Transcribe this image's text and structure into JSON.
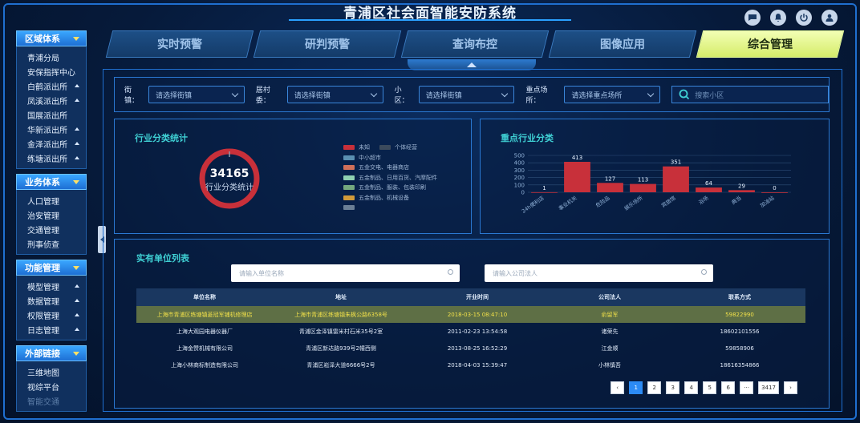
{
  "app": {
    "title": "青浦区社会面智能安防系统"
  },
  "header": {
    "icons": [
      "chat-icon",
      "bell-icon",
      "power-icon",
      "user-icon"
    ]
  },
  "tabs": [
    {
      "label": "实时预警",
      "active": false
    },
    {
      "label": "研判预警",
      "active": false
    },
    {
      "label": "查询布控",
      "active": false
    },
    {
      "label": "图像应用",
      "active": false
    },
    {
      "label": "综合管理",
      "active": true
    }
  ],
  "sidebar": {
    "groups": [
      {
        "label": "区域体系",
        "items": [
          {
            "label": "青浦分局",
            "expand": false
          },
          {
            "label": "安保指挥中心",
            "expand": false
          },
          {
            "label": "白鹤派出所",
            "expand": true
          },
          {
            "label": "凤溪派出所",
            "expand": true
          },
          {
            "label": "国展派出所",
            "expand": false
          },
          {
            "label": "华新派出所",
            "expand": true
          },
          {
            "label": "金泽派出所",
            "expand": true
          },
          {
            "label": "练塘派出所",
            "expand": true
          }
        ]
      },
      {
        "label": "业务体系",
        "items": [
          {
            "label": "人口管理",
            "expand": false
          },
          {
            "label": "治安管理",
            "expand": false
          },
          {
            "label": "交通管理",
            "expand": false
          },
          {
            "label": "刑事侦查",
            "expand": false
          }
        ]
      },
      {
        "label": "功能管理",
        "items": [
          {
            "label": "模型管理",
            "expand": true
          },
          {
            "label": "数据管理",
            "expand": true
          },
          {
            "label": "权限管理",
            "expand": true
          },
          {
            "label": "日志管理",
            "expand": true
          }
        ]
      },
      {
        "label": "外部链接",
        "items": [
          {
            "label": "三维地图",
            "expand": false
          },
          {
            "label": "视综平台",
            "expand": false
          },
          {
            "label": "智能交通",
            "expand": false,
            "dim": true
          }
        ]
      }
    ]
  },
  "filters": {
    "street_label": "街镇：",
    "street_placeholder": "请选择街镇",
    "village_label": "居村委：",
    "village_placeholder": "请选择街镇",
    "community_label": "小区：",
    "community_placeholder": "请选择街镇",
    "venue_label": "重点场所：",
    "venue_placeholder": "请选择重点场所",
    "search_placeholder": "搜索小区"
  },
  "industry_panel": {
    "title": "行业分类统计",
    "total": "34165",
    "subtitle": "行业分类统计",
    "legend": [
      {
        "label": "未知",
        "color": "#c8303a"
      },
      {
        "label": "个体经营",
        "color": "#3b4a5c"
      },
      {
        "label": "中小超市",
        "color": "#5a8fb0"
      },
      {
        "label": "五金交电、电器商店",
        "color": "#d1705a"
      },
      {
        "label": "五金制品、日用百货、汽摩配件",
        "color": "#8fd0b0"
      },
      {
        "label": "五金制品、服装、包装印刷",
        "color": "#74a87e"
      },
      {
        "label": "五金制品、机械设备",
        "color": "#d19a3a"
      },
      {
        "label": "",
        "color": "#6b7f95"
      }
    ]
  },
  "key_industry_panel": {
    "title": "重点行业分类"
  },
  "chart_data": {
    "type": "bar",
    "categories": [
      "24h便利店",
      "事业机关",
      "危险品",
      "娱乐场所",
      "宾旅馆",
      "浴场",
      "典当",
      "加油站"
    ],
    "values": [
      1,
      413,
      127,
      113,
      351,
      64,
      29,
      0
    ],
    "ylim": [
      0,
      500
    ],
    "yticks": [
      0,
      100,
      200,
      300,
      400,
      500
    ],
    "bar_color": "#c8303a",
    "grid": true
  },
  "units_panel": {
    "title": "实有单位列表",
    "unit_search_placeholder": "请输入单位名称",
    "person_search_placeholder": "请输入公司法人",
    "columns": [
      "单位名称",
      "地址",
      "开业时间",
      "公司法人",
      "联系方式"
    ],
    "rows": [
      [
        "上海市青浦区练塘镇菱冠军铺机修理店",
        "上海市青浦区练塘镇朱枫公路6358号",
        "2018-03-15 08:47:10",
        "俞留军",
        "59822990"
      ],
      [
        "上海大观园电器仪器厂",
        "青浦区金泽镇雷米村石米35号2室",
        "2011-02-23 13:54:58",
        "诸荣先",
        "18602101556"
      ],
      [
        "上海金赞机械有限公司",
        "青浦区新达路939号2幢西侧",
        "2013-08-25 16:52:29",
        "江金顺",
        "59858906"
      ],
      [
        "上海小林商标制造有限公司",
        "青浦区崧泽大道6666号2号",
        "2018-04-03 15:39:47",
        "小林慎吾",
        "18616354866"
      ]
    ],
    "highlight_row": 0
  },
  "pagination": {
    "prev": "‹",
    "pages": [
      "1",
      "2",
      "3",
      "4",
      "5",
      "6"
    ],
    "ellipsis": "···",
    "last": "3417",
    "next": "›",
    "current": "1"
  }
}
